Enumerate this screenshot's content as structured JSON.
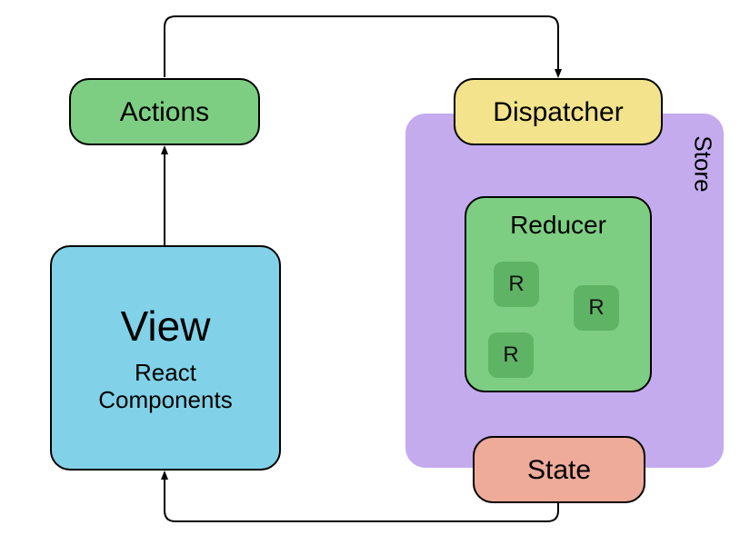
{
  "nodes": {
    "actions": {
      "label": "Actions",
      "color": "#7dce82"
    },
    "dispatcher": {
      "label": "Dispatcher",
      "color": "#f2e38c"
    },
    "store": {
      "label": "Store",
      "color": "#c4abee"
    },
    "reducer": {
      "label": "Reducer",
      "color": "#7dce82",
      "children": [
        {
          "label": "R"
        },
        {
          "label": "R"
        },
        {
          "label": "R"
        }
      ]
    },
    "state": {
      "label": "State",
      "color": "#eeab9a"
    },
    "view": {
      "title": "View",
      "subtitle": "React\nComponents",
      "color": "#81d2e8"
    }
  },
  "edges": [
    {
      "from": "view",
      "to": "actions"
    },
    {
      "from": "actions",
      "to": "dispatcher"
    },
    {
      "from": "dispatcher",
      "to": "reducer"
    },
    {
      "from": "reducer",
      "to": "state"
    },
    {
      "from": "state",
      "to": "reducer"
    },
    {
      "from": "state",
      "to": "view"
    }
  ]
}
